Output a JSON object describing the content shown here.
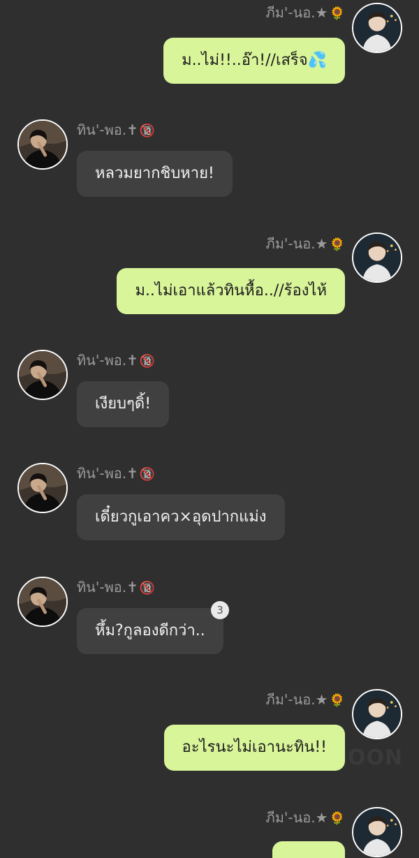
{
  "colors": {
    "background": "#2f2f2f",
    "my_bubble": "#d9f59a",
    "their_bubble": "#404040",
    "name_text": "#9a9a9a"
  },
  "users": {
    "me": {
      "name": "ภีม'-นอ.★",
      "emoji": "🌻",
      "avatar_icon": "avatar-photo-icon"
    },
    "them": {
      "name": "ทิน'-พอ.✝",
      "emoji": "🔞",
      "avatar_icon": "avatar-photo-icon"
    }
  },
  "messages": [
    {
      "sender": "me",
      "name": "ภีม'-นอ.★",
      "emoji": "🌻",
      "text": "ม..ไม่!!..อ๊า!//เสร็จ💦"
    },
    {
      "sender": "them",
      "name": "ทิน'-พอ.✝",
      "emoji": "🔞",
      "text": "หลวมยากชิบหาย!"
    },
    {
      "sender": "me",
      "name": "ภีม'-นอ.★",
      "emoji": "🌻",
      "text": "ม..ไม่เอาแล้วทินหื้อ..//ร้องไห้"
    },
    {
      "sender": "them",
      "name": "ทิน'-พอ.✝",
      "emoji": "🔞",
      "text": "เงียบๆดิ้!"
    },
    {
      "sender": "them",
      "name": "ทิน'-พอ.✝",
      "emoji": "🔞",
      "text": "เดี๋ยวกูเอาคว×อุดปากแม่ง"
    },
    {
      "sender": "them",
      "name": "ทิน'-พอ.✝",
      "emoji": "🔞",
      "text": "หึ้ม?กูลองดีกว่า..",
      "comment_count": "3"
    },
    {
      "sender": "me",
      "name": "ภีม'-นอ.★",
      "emoji": "🌻",
      "text": "อะไรนะไม่เอานะทิน!!"
    },
    {
      "sender": "me",
      "name": "ภีม'-นอ.★",
      "emoji": "🌻",
      "text": ""
    }
  ],
  "watermark": "OON"
}
